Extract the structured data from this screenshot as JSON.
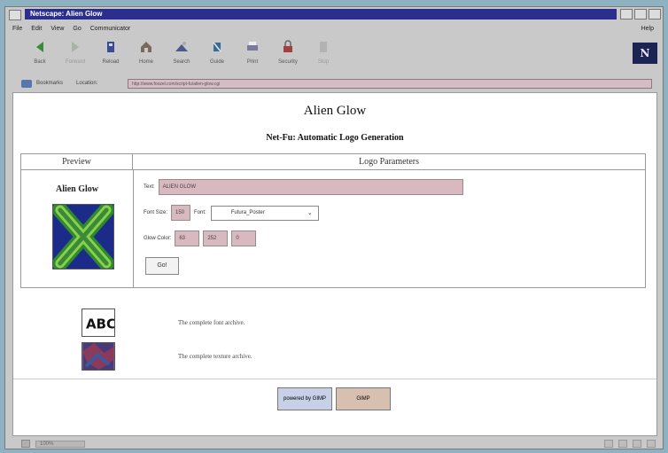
{
  "window": {
    "title": "Netscape: Alien Glow",
    "colors": {
      "titlebar": "#2b2e8c",
      "chrome": "#c9c9c9",
      "desktop": "#8fb2c2"
    }
  },
  "menu": {
    "items": [
      "File",
      "Edit",
      "View",
      "Go",
      "Communicator"
    ],
    "help": "Help"
  },
  "toolbar": {
    "buttons": [
      {
        "label": "Back",
        "icon": "back-arrow-icon"
      },
      {
        "label": "Forward",
        "icon": "forward-arrow-icon"
      },
      {
        "label": "Reload",
        "icon": "reload-icon"
      },
      {
        "label": "Home",
        "icon": "home-icon"
      },
      {
        "label": "Search",
        "icon": "search-icon"
      },
      {
        "label": "Guide",
        "icon": "guide-icon"
      },
      {
        "label": "Print",
        "icon": "print-icon"
      },
      {
        "label": "Security",
        "icon": "security-lock-icon"
      },
      {
        "label": "Stop",
        "icon": "stop-icon"
      }
    ],
    "logo": "N"
  },
  "location": {
    "bookmarks_label": "Bookmarks",
    "location_label": "Location:",
    "url": "http://www.foozel.com/script-fu/alien-glow.cgi"
  },
  "page": {
    "title": "Alien Glow",
    "subtitle": "Net-Fu: Automatic Logo Generation",
    "table": {
      "preview_header": "Preview",
      "params_header": "Logo Parameters",
      "preview_text": "Alien Glow"
    },
    "params": {
      "text_label": "Text:",
      "text_value": "ALIEN GLOW",
      "font_size_label": "Font Size:",
      "font_size_value": "150",
      "font_label": "Font:",
      "font_value": "Futura_Poster",
      "glow_color_label": "Glow Color:",
      "glow_r": "63",
      "glow_g": "252",
      "glow_b": "0",
      "go_button": "Go!"
    },
    "archives": {
      "font_archive": "The complete font archive.",
      "texture_archive": "The complete texture archive."
    },
    "badges": {
      "left": "powered by GIMP",
      "right": "GIMP"
    }
  },
  "status": {
    "progress_text": "100%"
  }
}
